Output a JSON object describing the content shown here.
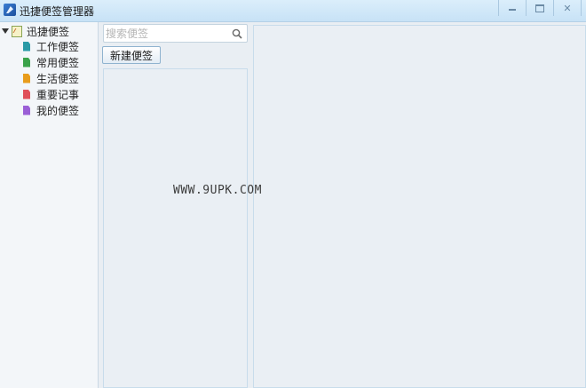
{
  "window": {
    "title": "迅捷便签管理器",
    "controls": [
      "minimize",
      "maximize",
      "close"
    ]
  },
  "sidebar": {
    "root": {
      "label": "迅捷便签",
      "icon": "notebook-icon",
      "expanded": true
    },
    "items": [
      {
        "label": "工作便签",
        "icon": "note-icon",
        "color": "#2a9aa6"
      },
      {
        "label": "常用便签",
        "icon": "note-icon",
        "color": "#3aa24a"
      },
      {
        "label": "生活便签",
        "icon": "note-icon",
        "color": "#e89c1c"
      },
      {
        "label": "重要记事",
        "icon": "note-icon",
        "color": "#e0505a"
      },
      {
        "label": "我的便签",
        "icon": "note-icon",
        "color": "#9a5fd6"
      }
    ]
  },
  "search": {
    "placeholder": "搜索便签",
    "value": "",
    "icon": "search-icon"
  },
  "toolbar": {
    "new_note_label": "新建便签"
  },
  "overlay": {
    "watermark": "WWW.9UPK.COM"
  },
  "colors": {
    "titlebar": "#c7e2f6",
    "background": "#e9eef3",
    "border": "#c8dceb"
  }
}
